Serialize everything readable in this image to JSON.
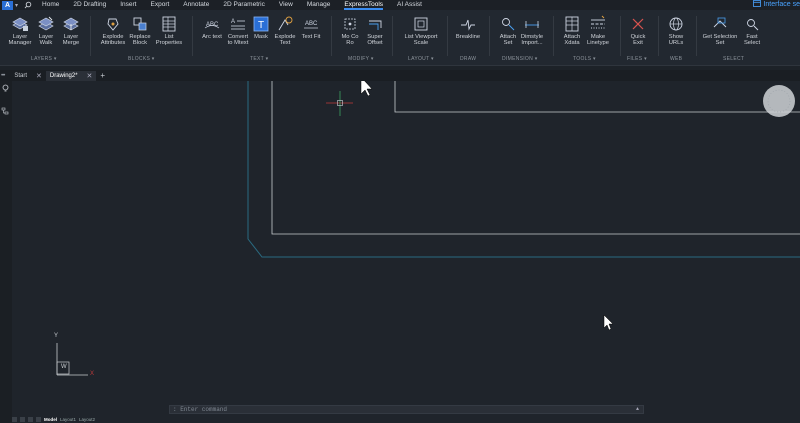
{
  "app": {
    "logo_letter": "A",
    "menu": [
      "Home",
      "2D Drafting",
      "Insert",
      "Export",
      "Annotate",
      "2D Parametric",
      "View",
      "Manage",
      "ExpressTools",
      "AI Assist"
    ],
    "active_menu": "ExpressTools",
    "interface_link": "Interface se"
  },
  "ribbon": {
    "tools": {
      "layer_manager": "Layer\nManager",
      "layer_walk": "Layer\nWalk",
      "layer_merge": "Layer\nMerge",
      "explode_attributes": "Explode\nAttributes",
      "replace_block": "Replace\nBlock",
      "list_properties": "List\nProperties",
      "arc_text": "Arc text",
      "convert_to_mtext": "Convert\nto Mtext",
      "mask": "Mask",
      "explode_text": "Explode\nText",
      "text_fit": "Text Fit",
      "mo_co_ro": "Mo Co\nRo",
      "super_offset": "Super\nOffset",
      "list_viewport_scale": "List Viewport\nScale",
      "breakline": "Breakline",
      "attach_set": "Attach\nSet",
      "dimstyle_import": "Dimstyle\nImport...",
      "attach_xdata": "Attach\nXdata",
      "make_linetype": "Make\nLinetype",
      "quick_exit": "Quick\nExit",
      "show_urls": "Show\nURLs",
      "get_selection_set": "Get Selection\nSet",
      "fast_select": "Fast\nSelect"
    },
    "groups": {
      "layers": "LAYERS",
      "blocks": "BLOCKS",
      "text": "TEXT",
      "modify": "MODIFY",
      "layout": "LAYOUT",
      "draw": "DRAW",
      "dimension": "DIMENSION",
      "tools": "TOOLS",
      "files": "FILES",
      "web": "WEB",
      "select": "SELECT"
    }
  },
  "doc_tabs": {
    "start": "Start",
    "drawing": "Drawing2*"
  },
  "canvas": {
    "ucs_y": "Y",
    "ucs_x": "X",
    "ucs_w": "W",
    "command_placeholder": ": Enter command"
  },
  "layout_tabs": {
    "model": "Model",
    "layout1": "Layout1",
    "layout2": "Layout2"
  },
  "colors": {
    "accent": "#3a8cf0",
    "viewport_border": "#2a6a80",
    "paper_border": "#c8ccd0",
    "quick_exit_red": "#d9534f"
  }
}
